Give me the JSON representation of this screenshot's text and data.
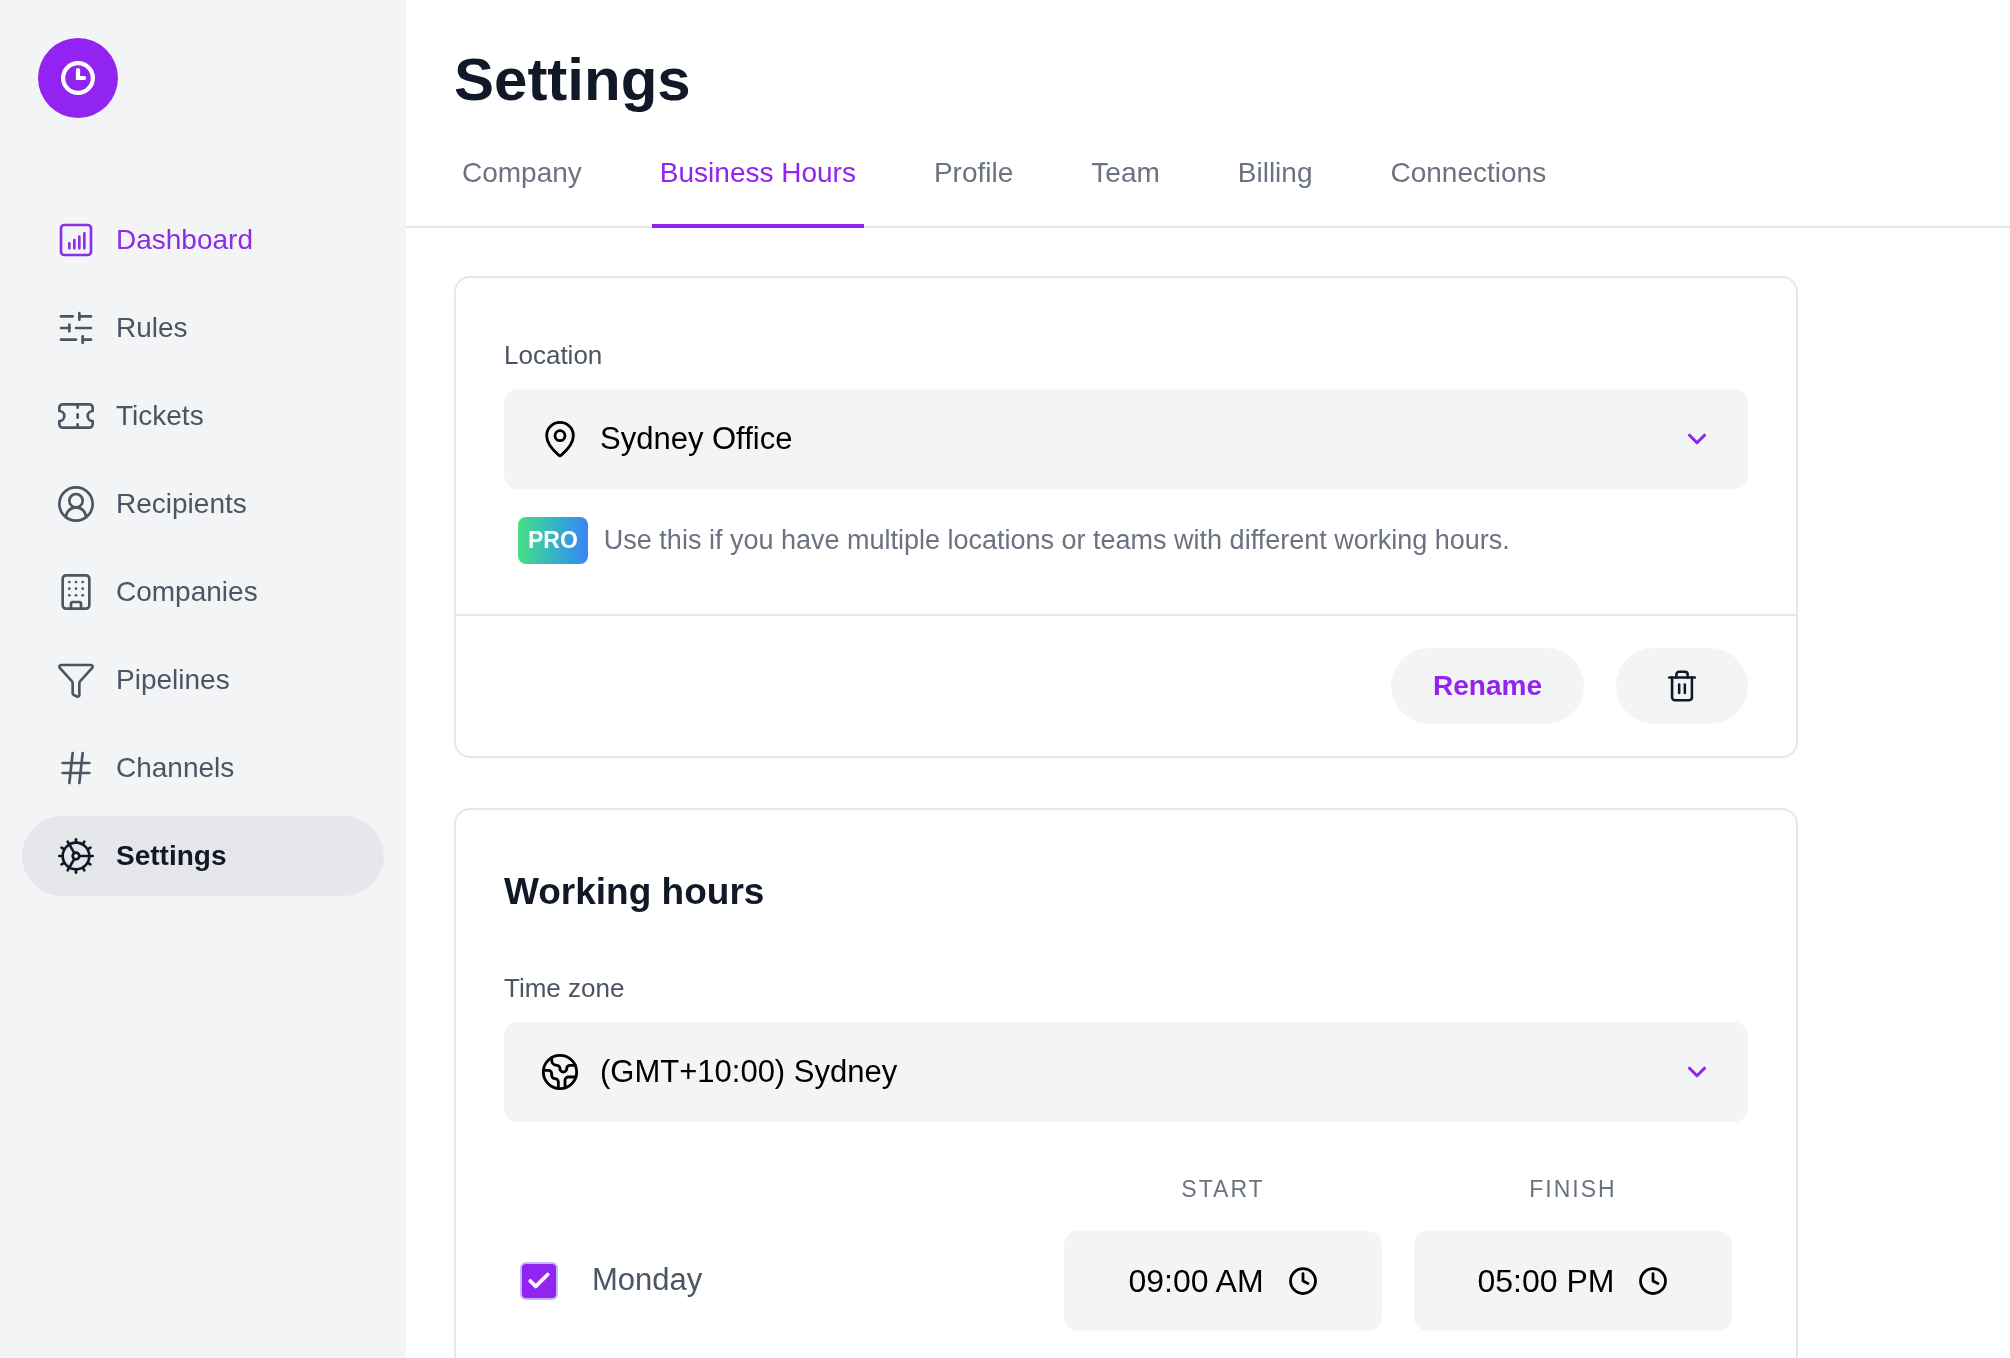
{
  "sidebar": {
    "items": [
      {
        "label": "Dashboard",
        "kind": "dashboard",
        "accent": true,
        "selected": false
      },
      {
        "label": "Rules",
        "kind": "sliders",
        "accent": false,
        "selected": false
      },
      {
        "label": "Tickets",
        "kind": "ticket",
        "accent": false,
        "selected": false
      },
      {
        "label": "Recipients",
        "kind": "user",
        "accent": false,
        "selected": false
      },
      {
        "label": "Companies",
        "kind": "building",
        "accent": false,
        "selected": false
      },
      {
        "label": "Pipelines",
        "kind": "funnel",
        "accent": false,
        "selected": false
      },
      {
        "label": "Channels",
        "kind": "hash",
        "accent": false,
        "selected": false
      },
      {
        "label": "Settings",
        "kind": "gear",
        "accent": false,
        "selected": true
      }
    ]
  },
  "page": {
    "title": "Settings"
  },
  "tabs": [
    {
      "label": "Company",
      "selected": false
    },
    {
      "label": "Business Hours",
      "selected": true
    },
    {
      "label": "Profile",
      "selected": false
    },
    {
      "label": "Team",
      "selected": false
    },
    {
      "label": "Billing",
      "selected": false
    },
    {
      "label": "Connections",
      "selected": false
    }
  ],
  "location": {
    "label": "Location",
    "value": "Sydney Office",
    "badge": "PRO",
    "hint": "Use this if you have multiple locations or teams with different working hours.",
    "rename_button": "Rename"
  },
  "working_hours": {
    "title": "Working hours",
    "timezone": {
      "label": "Time zone",
      "value": "(GMT+10:00) Sydney"
    },
    "columns": [
      "START",
      "FINISH"
    ],
    "days": [
      {
        "name": "Monday",
        "checked": true,
        "start": "09:00 AM",
        "finish": "05:00 PM"
      }
    ]
  }
}
